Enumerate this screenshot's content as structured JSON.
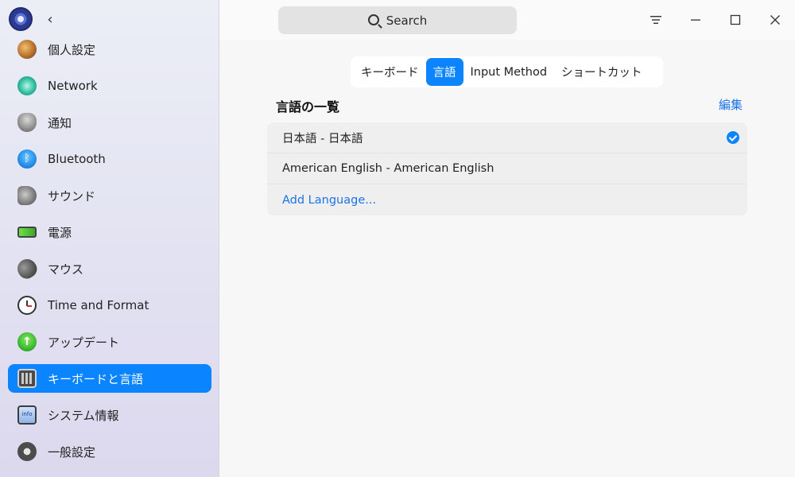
{
  "titlebar": {
    "search_placeholder": "Search"
  },
  "sidebar": {
    "items": [
      {
        "label": "個人設定",
        "icon": "personalization-icon"
      },
      {
        "label": "Network",
        "icon": "network-icon"
      },
      {
        "label": "通知",
        "icon": "notification-bell-icon"
      },
      {
        "label": "Bluetooth",
        "icon": "bluetooth-icon"
      },
      {
        "label": "サウンド",
        "icon": "speaker-icon"
      },
      {
        "label": "電源",
        "icon": "battery-icon"
      },
      {
        "label": "マウス",
        "icon": "mouse-icon"
      },
      {
        "label": "Time and Format",
        "icon": "clock-icon"
      },
      {
        "label": "アップデート",
        "icon": "update-arrow-icon"
      },
      {
        "label": "キーボードと言語",
        "icon": "keyboard-icon"
      },
      {
        "label": "システム情報",
        "icon": "system-info-icon"
      },
      {
        "label": "一般設定",
        "icon": "general-settings-icon"
      }
    ],
    "active_item": "キーボードと言語"
  },
  "tabs": [
    {
      "label": "キーボード"
    },
    {
      "label": "言語"
    },
    {
      "label": "Input Method"
    },
    {
      "label": "ショートカット"
    }
  ],
  "active_tab": "言語",
  "language_section": {
    "title": "言語の一覧",
    "edit_label": "編集",
    "languages": [
      {
        "label": "日本語 - 日本語",
        "selected": true
      },
      {
        "label": "American English - American English",
        "selected": false
      }
    ],
    "add_label": "Add Language..."
  },
  "colors": {
    "accent": "#0a84ff",
    "link": "#1a73e8"
  }
}
